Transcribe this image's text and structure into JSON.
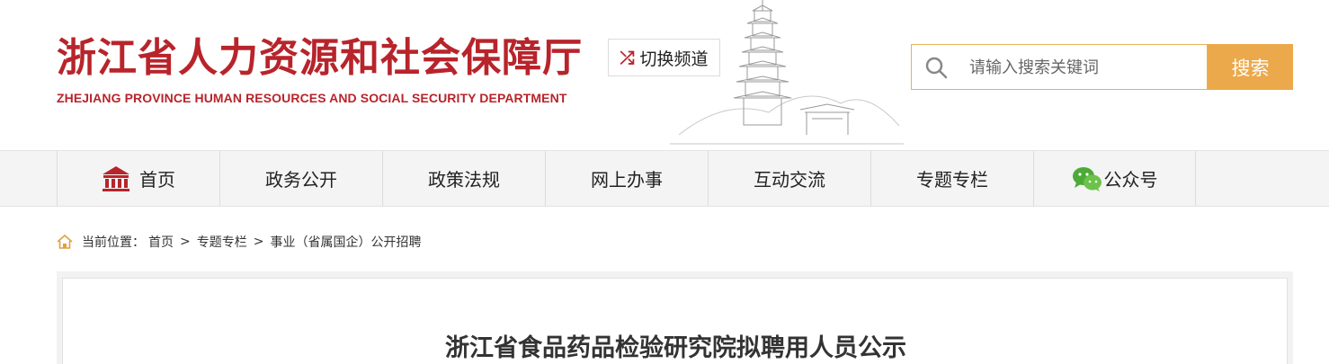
{
  "header": {
    "logo_cn": "浙江省人力资源和社会保障厅",
    "logo_en": "ZHEJIANG PROVINCE HUMAN RESOURCES AND SOCIAL SECURITY DEPARTMENT",
    "switch_channel": "切换频道",
    "switch_icon": "shuffle-icon",
    "search": {
      "placeholder": "请输入搜索关键词",
      "value": "",
      "button": "搜索"
    }
  },
  "nav": {
    "items": [
      {
        "label": "首页",
        "icon": "home-icon"
      },
      {
        "label": "政务公开"
      },
      {
        "label": "政策法规"
      },
      {
        "label": "网上办事"
      },
      {
        "label": "互动交流"
      },
      {
        "label": "专题专栏"
      },
      {
        "label": "公众号",
        "icon": "wechat-icon"
      }
    ]
  },
  "breadcrumb": {
    "prefix": "当前位置：",
    "items": [
      "首页",
      "专题专栏",
      "事业（省属国企）公开招聘"
    ],
    "separator": ">"
  },
  "article": {
    "title": "浙江省食品药品检验研究院拟聘用人员公示"
  },
  "colors": {
    "brand_red": "#b8242b",
    "accent_orange": "#eba94b",
    "nav_bg": "#f4f4f4"
  }
}
